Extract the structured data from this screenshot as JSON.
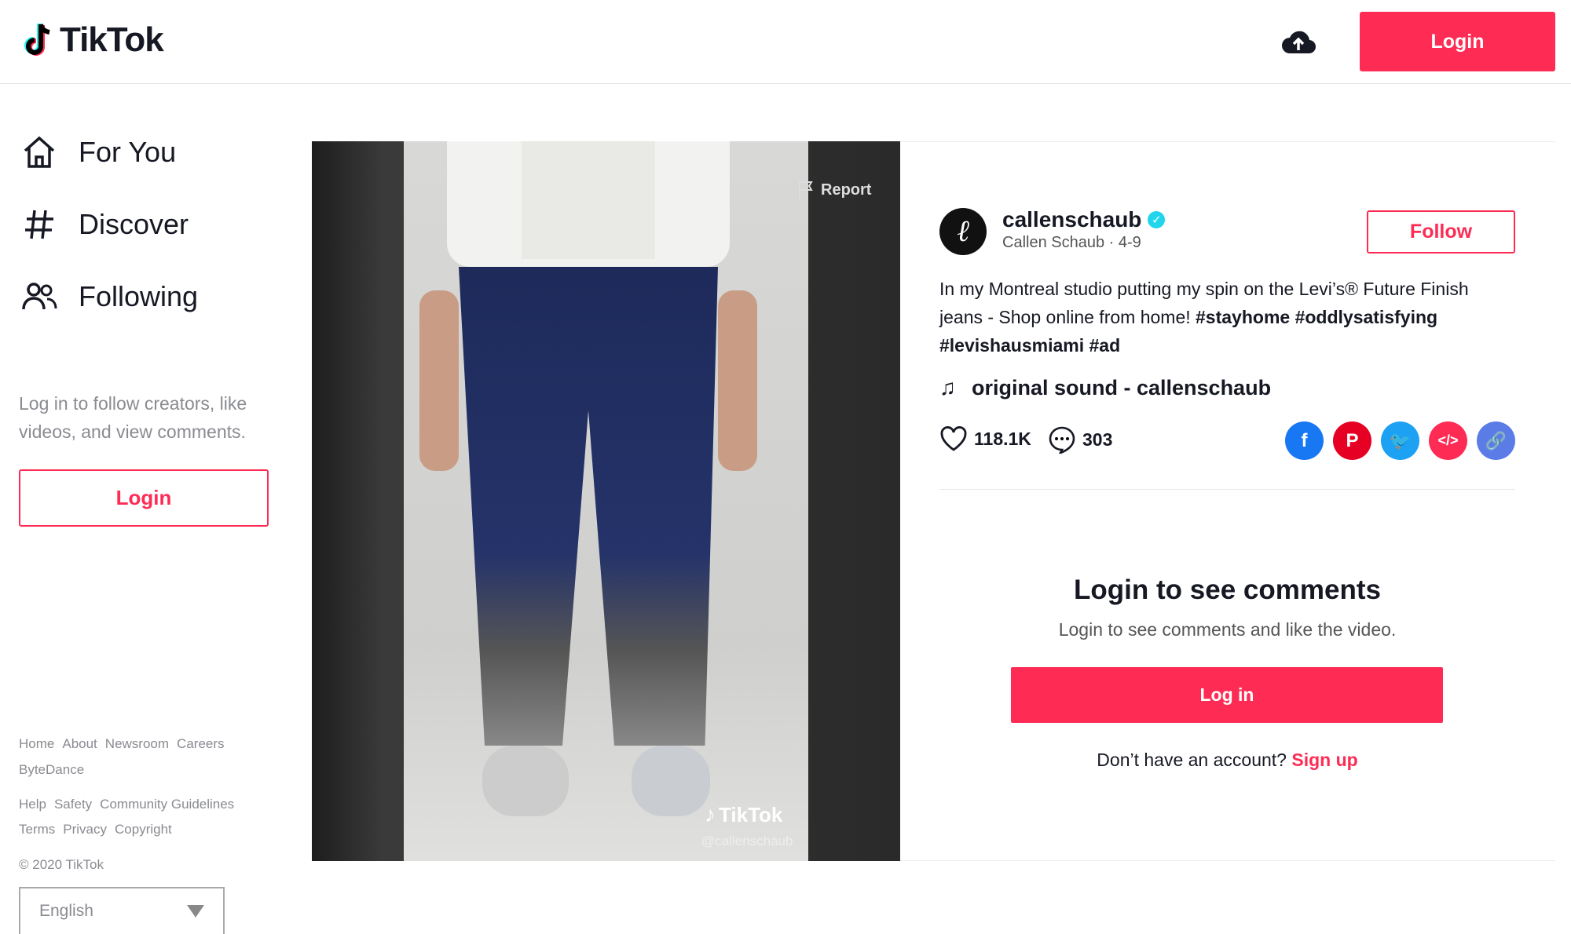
{
  "header": {
    "logo": "TikTok",
    "login": "Login",
    "upload_icon": "cloud-upload-icon"
  },
  "sidebar": {
    "nav": [
      {
        "label": "For You",
        "icon": "home-icon"
      },
      {
        "label": "Discover",
        "icon": "hashtag-icon"
      },
      {
        "label": "Following",
        "icon": "users-icon"
      }
    ],
    "prompt": "Log in to follow creators, like videos, and view comments.",
    "login": "Login",
    "footer": {
      "row1": [
        "Home",
        "About",
        "Newsroom",
        "Careers"
      ],
      "row2": [
        "ByteDance"
      ],
      "row3": [
        "Help",
        "Safety",
        "Community Guidelines"
      ],
      "row4": [
        "Terms",
        "Privacy",
        "Copyright"
      ],
      "copyright": "© 2020 TikTok"
    },
    "language": "English"
  },
  "video": {
    "report": "Report",
    "watermark": "TikTok",
    "handle": "@callenschaub"
  },
  "post": {
    "username": "callenschaub",
    "name_date": "Callen Schaub · 4-9",
    "follow": "Follow",
    "desc_text": "In my Montreal studio putting my spin on the Levi’s® Future Finish jeans - Shop online from home! ",
    "hashtags": "#stayhome #oddlysatisfying #levishausmiami #ad",
    "sound": "original sound - callenschaub",
    "likes": "118.1K",
    "comments": "303",
    "share": [
      {
        "icon": "facebook-icon",
        "color": "#1877f2"
      },
      {
        "icon": "pinterest-icon",
        "color": "#e60023"
      },
      {
        "icon": "twitter-icon",
        "color": "#1da1f2"
      },
      {
        "icon": "embed-icon",
        "color": "#fe2c55"
      },
      {
        "icon": "link-icon",
        "color": "#5b7ce6"
      }
    ]
  },
  "comments": {
    "title": "Login to see comments",
    "subtitle": "Login to see comments and like the video.",
    "login": "Log in",
    "no_account": "Don’t have an account?",
    "signup": "Sign up"
  },
  "colors": {
    "accent": "#fe2c55",
    "verified": "#20d5ec"
  }
}
